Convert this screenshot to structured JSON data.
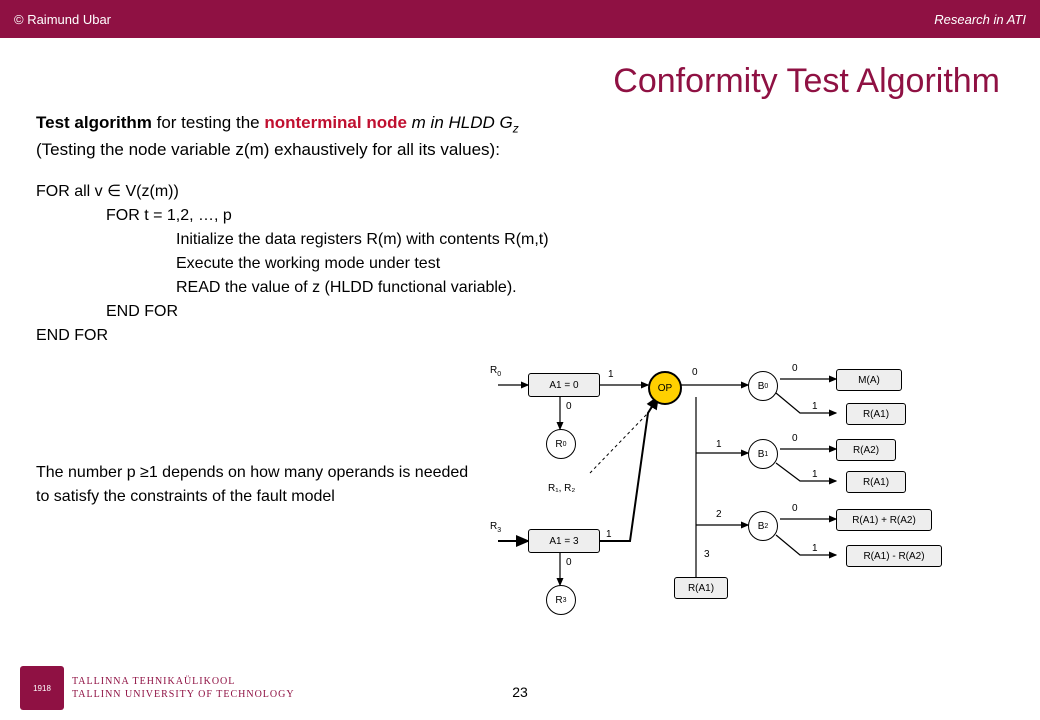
{
  "header": {
    "copyright": "© Raimund Ubar",
    "research": "Research in ATI"
  },
  "title": "Conformity Test Algorithm",
  "intro": {
    "l1a": "Test algorithm",
    "l1b": " for testing the ",
    "l1c": "nonterminal node",
    "l1d": " m in HLDD G",
    "l1sub": "z",
    "l2": "(Testing the node variable z(m) exhaustively for all its values):"
  },
  "algo": {
    "a1": "FOR all v ∈ V(z(m))",
    "a2": "FOR t = 1,2, …, p",
    "a3": "Initialize the data registers R(m) with contents R(m,t)",
    "a4": "Execute the working mode under test",
    "a5": "READ the value of z (HLDD functional variable).",
    "a6": "END FOR",
    "a7": "END FOR"
  },
  "note": "The number p ≥1 depends on how many operands is needed to satisfy the constraints of the fault model",
  "diagram": {
    "a1eq0": "A1 = 0",
    "a1eq3": "A1 = 3",
    "op": "OP",
    "b0": "B",
    "b0sub": "0",
    "b1": "B",
    "b1sub": "1",
    "b2": "B",
    "b2sub": "2",
    "r0": "R",
    "r0sub": "0",
    "r3": "R",
    "r3sub": "3",
    "ma": "M(A)",
    "ra1": "R(A1)",
    "ra2": "R(A2)",
    "rp": "R(A1) + R(A2)",
    "rm": "R(A1) - R(A2)",
    "lbl_r0": "R",
    "lbl_r0sub": "0",
    "lbl_r3": "R",
    "lbl_r3sub": "3",
    "lbl_r1r2": "R₁, R₂",
    "e0": "0",
    "e1": "1",
    "e2": "2",
    "e3": "3"
  },
  "footer": {
    "year": "1918",
    "uni1": "TALLINNA TEHNIKAÜLIKOOL",
    "uni2": "TALLINN UNIVERSITY OF TECHNOLOGY",
    "page": "23"
  }
}
